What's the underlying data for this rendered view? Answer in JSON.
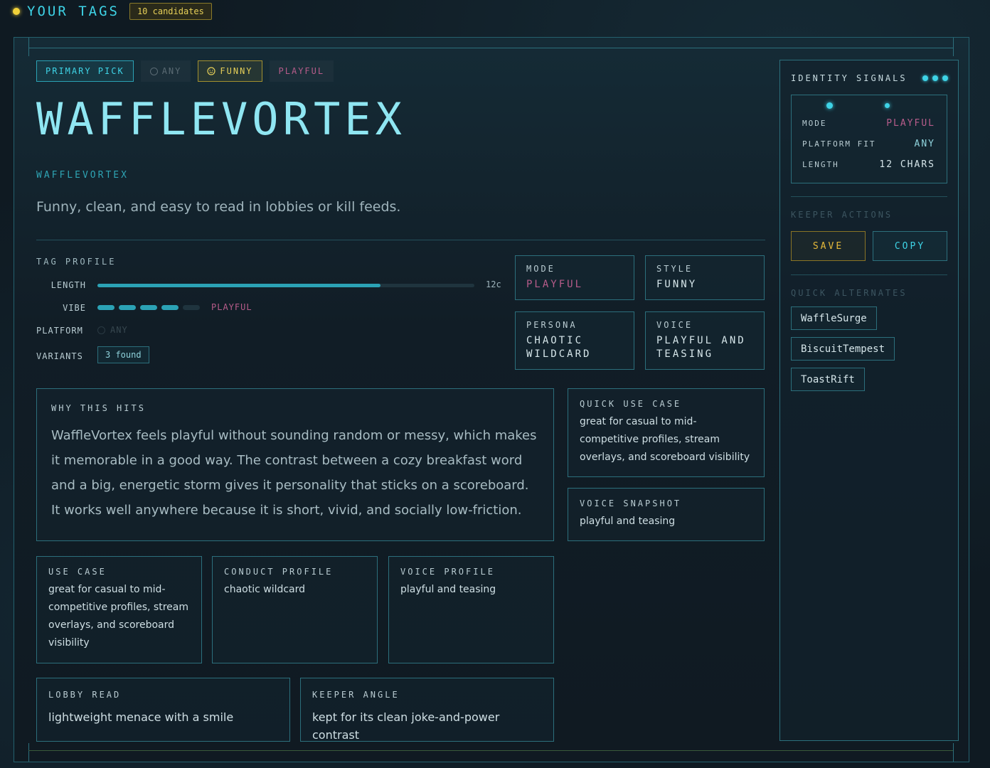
{
  "topbar": {
    "title": "YOUR TAGS",
    "badge": "10 candidates"
  },
  "chips": [
    {
      "label": "PRIMARY PICK",
      "style": "primary"
    },
    {
      "label": "ANY",
      "style": "any",
      "icon": "circle-icon"
    },
    {
      "label": "FUNNY",
      "style": "funny",
      "icon": "smiley-icon"
    },
    {
      "label": "PLAYFUL",
      "style": "playful"
    }
  ],
  "hero": {
    "title": "WAFFLEVORTEX",
    "subtitle": "WAFFLEVORTEX",
    "description": "Funny, clean, and easy to read in lobbies or kill feeds."
  },
  "profile": {
    "label": "TAG PROFILE",
    "length_label": "LENGTH",
    "length_value": "12c",
    "length_fraction": 0.75,
    "vibe_label": "VIBE",
    "vibe_level": 4,
    "vibe_max": 5,
    "vibe_value": "PLAYFUL",
    "platform_label": "PLATFORM",
    "platform_value": "ANY",
    "variants_label": "VARIANTS",
    "variants_value": "3 found"
  },
  "tiles": {
    "mode": {
      "label": "MODE",
      "value": "PLAYFUL"
    },
    "style": {
      "label": "STYLE",
      "value": "FUNNY"
    },
    "persona": {
      "label": "PERSONA",
      "value": "CHAOTIC WILDCARD"
    },
    "voice": {
      "label": "VOICE",
      "value": "PLAYFUL AND TEASING"
    }
  },
  "why": {
    "label": "WHY THIS HITS",
    "body": "WaffleVortex feels playful without sounding random or messy, which makes it memorable in a good way. The contrast between a cozy breakfast word and a big, energetic storm gives it personality that sticks on a scoreboard. It works well anywhere because it is short, vivid, and socially low-friction."
  },
  "quick_use": {
    "label": "QUICK USE CASE",
    "body": "great for casual to mid-competitive profiles, stream overlays, and scoreboard visibility"
  },
  "voice_snapshot": {
    "label": "VOICE SNAPSHOT",
    "body": "playful and teasing"
  },
  "use_case": {
    "label": "USE CASE",
    "body": "great for casual to mid-competitive profiles, stream overlays, and scoreboard visibility"
  },
  "conduct": {
    "label": "CONDUCT PROFILE",
    "body": "chaotic wildcard"
  },
  "voice_profile": {
    "label": "VOICE PROFILE",
    "body": "playful and teasing"
  },
  "lobby": {
    "label": "LOBBY READ",
    "body": "lightweight menace with a smile"
  },
  "keeper_angle": {
    "label": "KEEPER ANGLE",
    "body": "kept for its clean joke-and-power contrast"
  },
  "side": {
    "title": "IDENTITY SIGNALS",
    "signals": [
      {
        "key": "MODE",
        "value": "PLAYFUL",
        "color": "#b65c8a"
      },
      {
        "key": "PLATFORM FIT",
        "value": "ANY",
        "color": "#8fd3dc"
      },
      {
        "key": "LENGTH",
        "value": "12 CHARS",
        "color": "#d6e6ea"
      }
    ],
    "keeper_label": "KEEPER ACTIONS",
    "save_label": "SAVE",
    "copy_label": "COPY",
    "alternates_label": "QUICK ALTERNATES",
    "alternates": [
      "WaffleSurge",
      "BiscuitTempest",
      "ToastRift"
    ]
  },
  "colors": {
    "accent": "#3ed3e6",
    "pink": "#b65c8a",
    "gold": "#e6cf58"
  }
}
